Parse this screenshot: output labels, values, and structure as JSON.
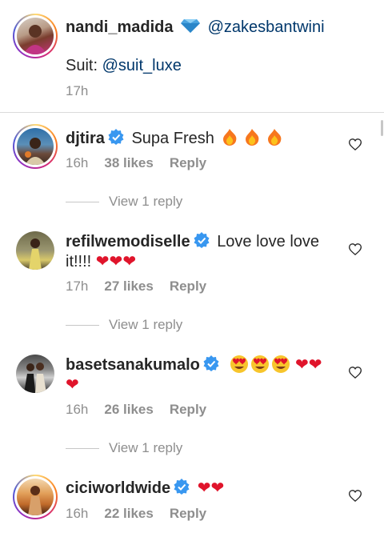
{
  "caption": {
    "username": "nandi_madida",
    "mention1": "@zakesbantwini",
    "text_prefix": "Suit: ",
    "mention2": "@suit_luxe",
    "time": "17h"
  },
  "comments": [
    {
      "username": "djtira",
      "text": "Supa Fresh",
      "time": "16h",
      "likes": "38 likes",
      "reply": "Reply",
      "view_replies": "View 1 reply"
    },
    {
      "username": "refilwemodiselle",
      "text": "Love love love",
      "text2": "it!!!!",
      "time": "17h",
      "likes": "27 likes",
      "reply": "Reply",
      "view_replies": "View 1 reply"
    },
    {
      "username": "basetsanakumalo",
      "time": "16h",
      "likes": "26 likes",
      "reply": "Reply",
      "view_replies": "View 1 reply"
    },
    {
      "username": "ciciworldwide",
      "time": "16h",
      "likes": "22 likes",
      "reply": "Reply"
    }
  ],
  "colors": {
    "verified": "#3897f0",
    "heart": "#e0142b",
    "secondary": "#8e8e8e"
  }
}
